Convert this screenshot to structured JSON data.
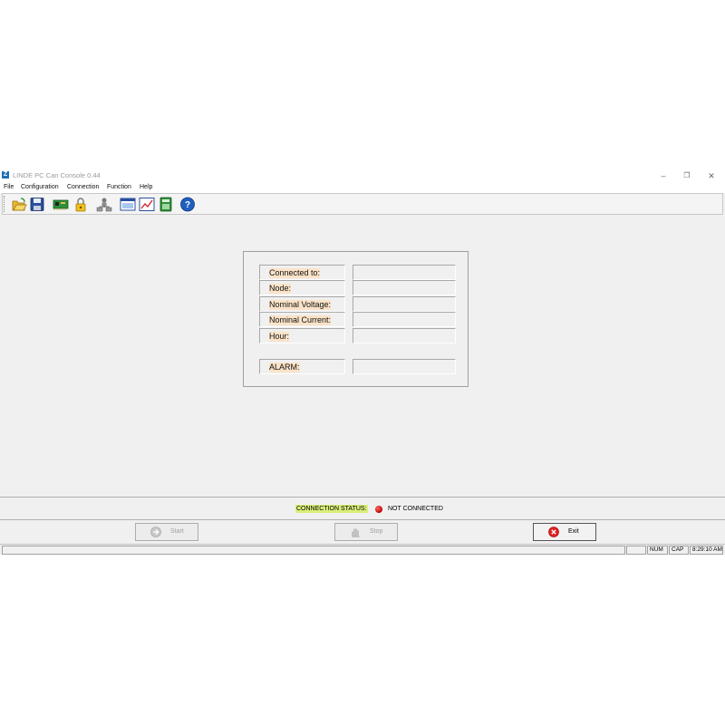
{
  "window": {
    "title": "LINDE PC Can Console 0.44",
    "icon_name": "app-logo-icon",
    "controls": {
      "minimize": "–",
      "restore": "❐",
      "close": "✕"
    }
  },
  "menu": [
    "File",
    "Configuration",
    "Connection",
    "Function",
    "Help"
  ],
  "toolbar": [
    {
      "name": "open-folder-icon"
    },
    {
      "name": "save-disk-icon"
    },
    {
      "name": "can-card-icon"
    },
    {
      "name": "lock-icon"
    },
    {
      "name": "network-users-icon"
    },
    {
      "name": "monitor-window-icon"
    },
    {
      "name": "chart-icon"
    },
    {
      "name": "calculator-icon"
    },
    {
      "name": "help-icon"
    }
  ],
  "info": {
    "connected_to": "Connected to:",
    "node": "Node:",
    "nominal_voltage": "Nominal Voltage:",
    "nominal_current": "Nominal Current:",
    "hour": "Hour:",
    "alarm": "ALARM:"
  },
  "connection": {
    "label": "CONNECTION STATUS:",
    "status": "NOT CONNECTED",
    "status_color": "#d00000",
    "label_highlight": "#d9ef7a"
  },
  "buttons": {
    "start": "Start",
    "stop": "Stop",
    "exit": "Exit"
  },
  "statusbar": {
    "num": "NUM",
    "cap": "CAP",
    "time": "8:29:10 AM"
  }
}
